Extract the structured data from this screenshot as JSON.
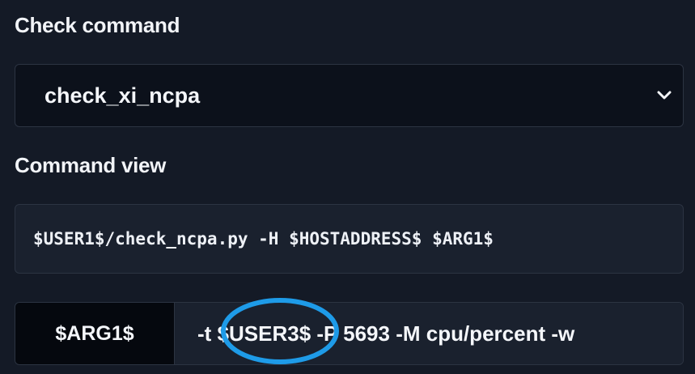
{
  "check_command": {
    "label": "Check command",
    "selected": "check_xi_ncpa",
    "chevron_icon": "chevron-down-icon"
  },
  "command_view": {
    "label": "Command view",
    "text": "$USER1$/check_ncpa.py -H $HOSTADDRESS$ $ARG1$"
  },
  "arguments": [
    {
      "name": "$ARG1$",
      "value": "-t $USER3$ -P 5693 -M cpu/percent -w"
    }
  ],
  "annotation": {
    "shape": "ellipse",
    "color": "#1e9be8",
    "highlights": "$USER3$"
  },
  "colors": {
    "background": "#141a26",
    "field_dark": "#0c111b",
    "field": "#1a212e",
    "border": "#2c3442",
    "arg_name_bg": "#05080e"
  }
}
